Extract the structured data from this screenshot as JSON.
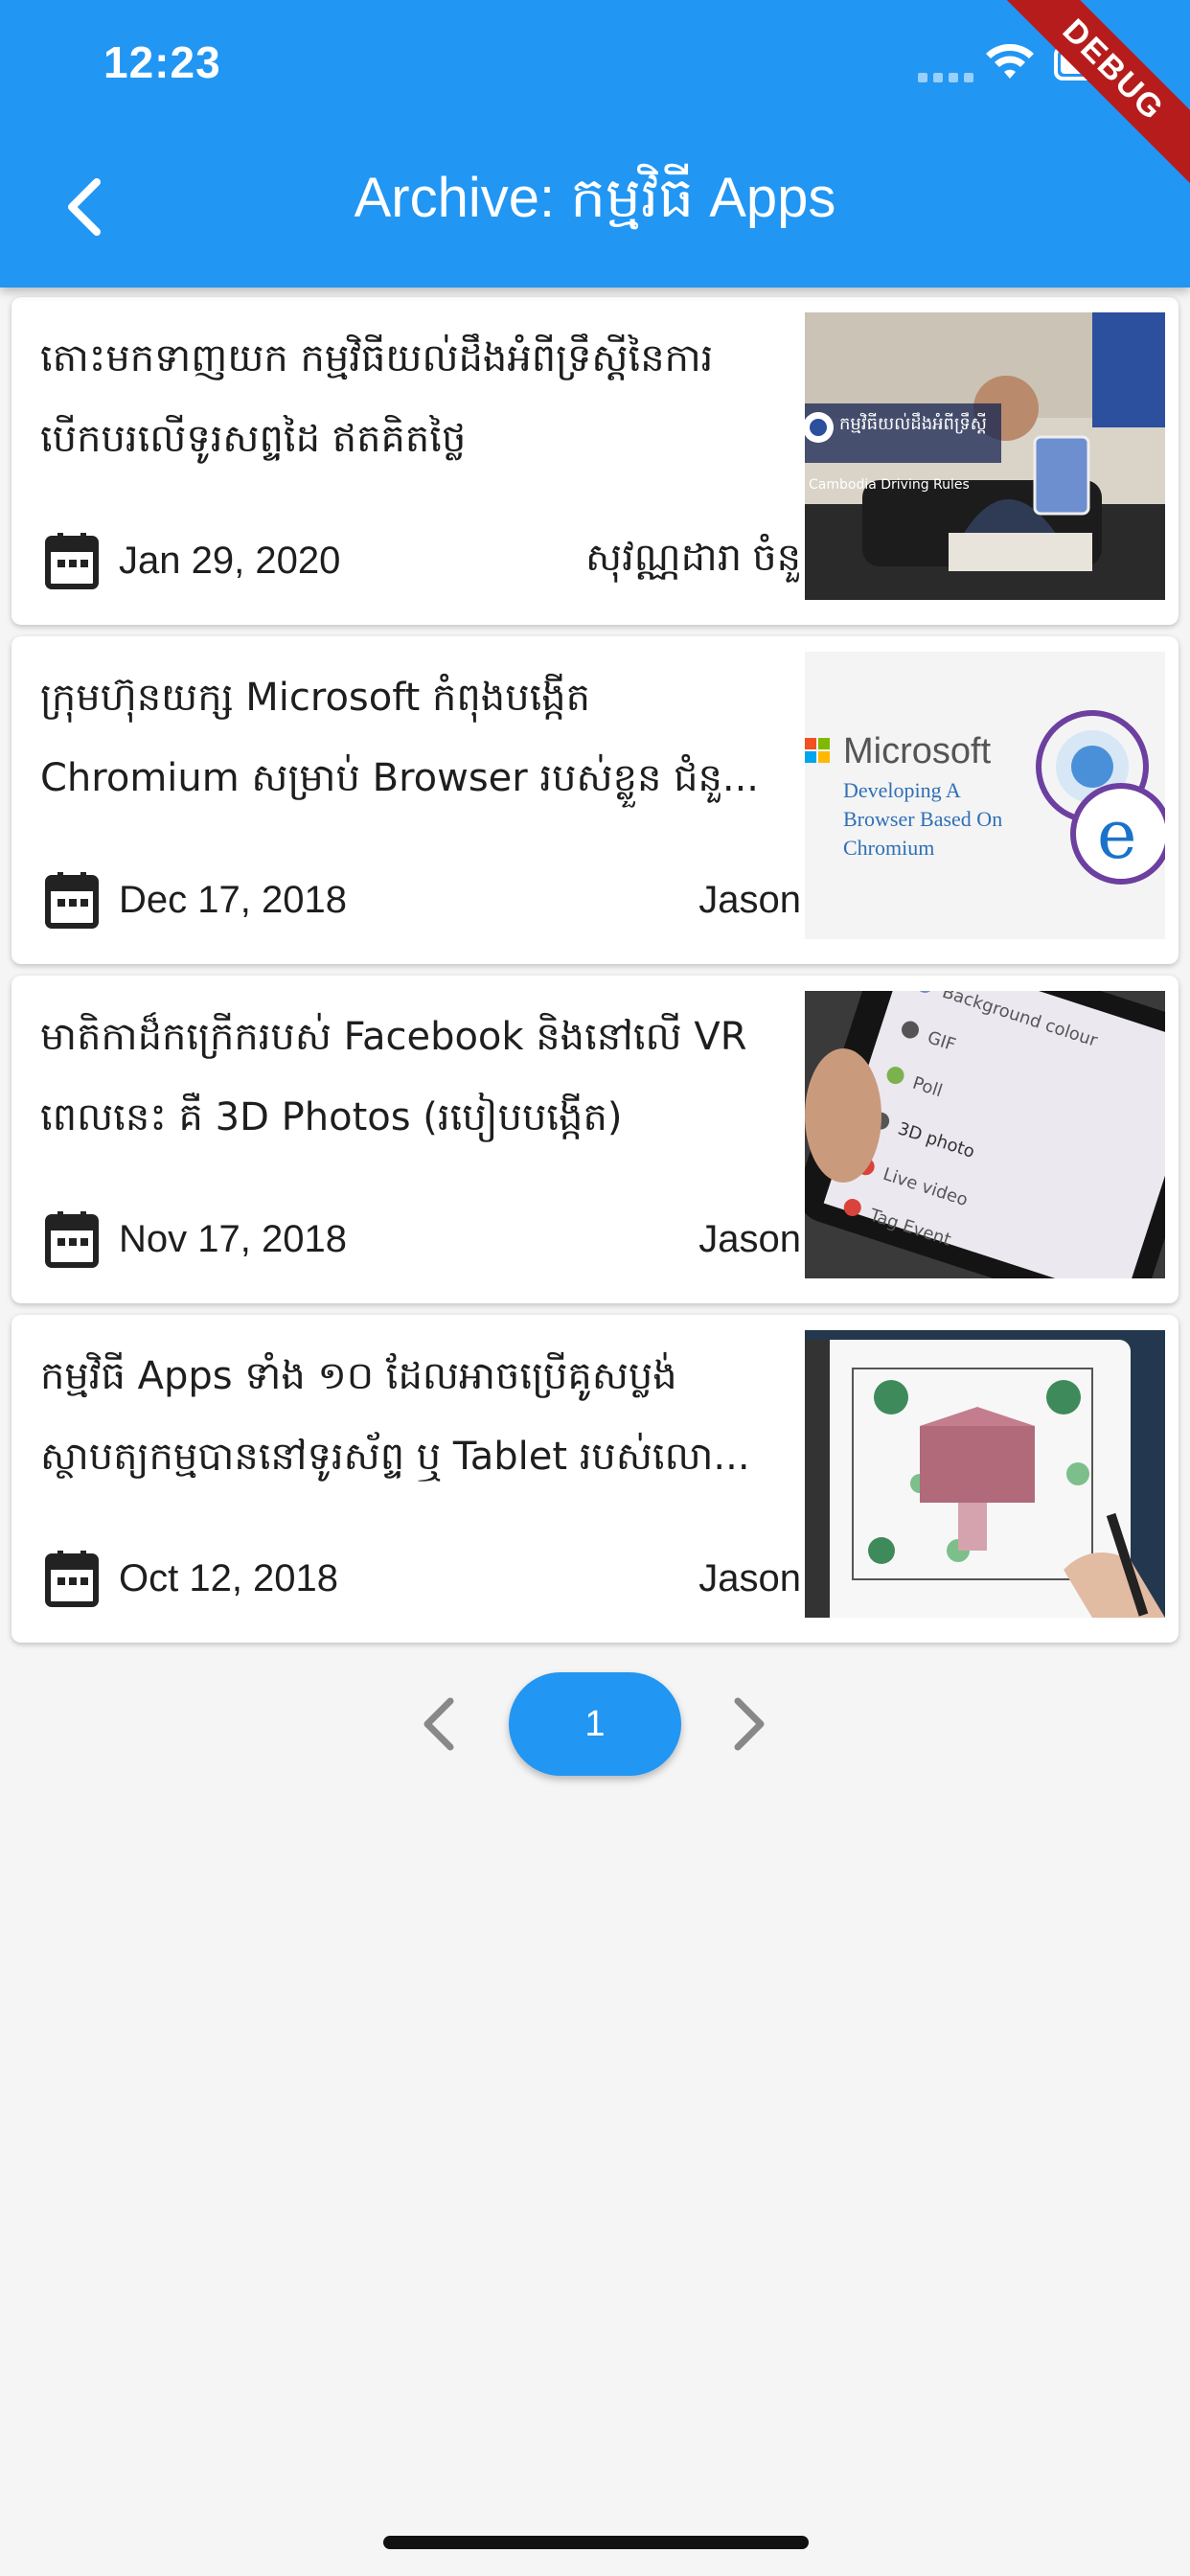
{
  "status_bar": {
    "time": "12:23"
  },
  "debug_banner": "DEBUG",
  "app_bar": {
    "title": "Archive: កម្មវិធី Apps",
    "back_icon": "chevron-left-icon"
  },
  "posts": [
    {
      "title": "តោះមកទាញយក កម្មវិធីយល់ដឹងអំពីទ្រឹស្តីនៃការបើកបរលើទូរសព្ទដៃ ឥតគិតថ្លៃ",
      "date": "Jan 29, 2020",
      "author": "សុវណ្ណដារា ចំនួ",
      "thumb_text": "កម្មវិធីយល់ដឹងអំពីទ្រឹស្តី",
      "thumb_sub": "Cambodia Driving Rules"
    },
    {
      "title": "ក្រុមហ៊ុនយក្ស Microsoft កំពុងបង្កើត Chromium សម្រាប់ Browser របស់ខ្លួន ជំនួ...",
      "date": "Dec 17, 2018",
      "author": "Jason",
      "thumb_text": "Microsoft",
      "thumb_sub": "Developing A Browser Based On Chromium"
    },
    {
      "title": "មាតិកាដ៏កក្រើករបស់ Facebook និងនៅលើ VR ពេលនេះ គឺ 3D Photos (របៀបបង្កើត)",
      "date": "Nov 17, 2018",
      "author": "Jason",
      "thumb_text": "Background colour",
      "thumb_sub": "3D photo"
    },
    {
      "title": "កម្មវិធី Apps ទាំង ១០ ដែលអាចប្រើគូសប្លង់ស្ថាបត្យកម្មបាននៅទូរស័ព្ទ ឬ Tablet របស់លោ...",
      "date": "Oct 12, 2018",
      "author": "Jason",
      "thumb_text": "",
      "thumb_sub": ""
    }
  ],
  "pagination": {
    "current_page": "1",
    "prev_icon": "chevron-left-icon",
    "next_icon": "chevron-right-icon"
  },
  "colors": {
    "primary": "#2196f3",
    "debug": "#b71c1c",
    "background": "#f5f5f5"
  }
}
